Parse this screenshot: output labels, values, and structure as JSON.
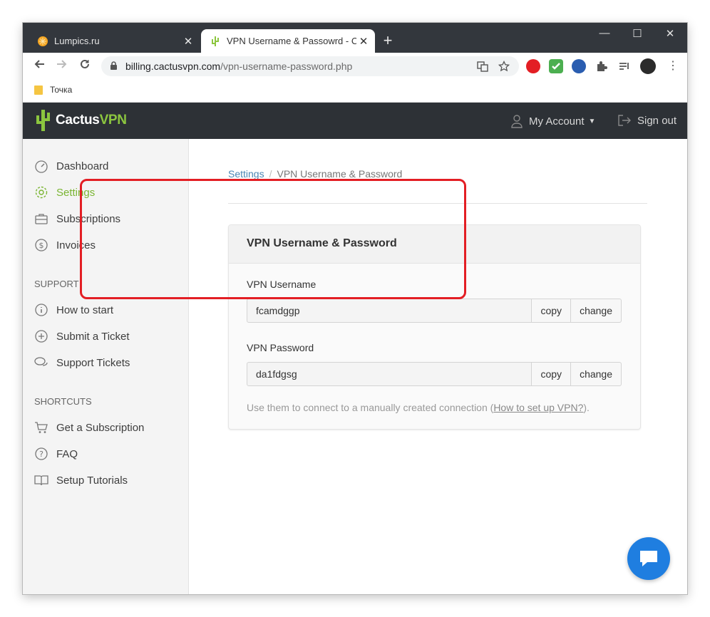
{
  "browser": {
    "tabs": [
      {
        "title": "Lumpics.ru",
        "active": false
      },
      {
        "title": "VPN Username & Passowrd - Cac",
        "active": true
      }
    ],
    "close_glyph": "✕",
    "new_tab_glyph": "+",
    "window_controls": {
      "minimize": "—",
      "maximize": "☐",
      "close": "✕"
    },
    "url_host": "billing.cactusvpn.com",
    "url_path": "/vpn-username-password.php",
    "bookmark": "Точка"
  },
  "header": {
    "logo_cactus": "Cactus",
    "logo_vpn": "VPN",
    "account_label": "My Account",
    "signout_label": "Sign out"
  },
  "sidebar": {
    "items": [
      {
        "label": "Dashboard",
        "icon": "dashboard-icon"
      },
      {
        "label": "Settings",
        "icon": "gear-icon",
        "active": true
      },
      {
        "label": "Subscriptions",
        "icon": "briefcase-icon"
      },
      {
        "label": "Invoices",
        "icon": "dollar-icon"
      }
    ],
    "support_heading": "SUPPORT",
    "support_items": [
      {
        "label": "How to start",
        "icon": "info-icon"
      },
      {
        "label": "Submit a Ticket",
        "icon": "plus-bubble-icon"
      },
      {
        "label": "Support Tickets",
        "icon": "chat-bubbles-icon"
      }
    ],
    "shortcuts_heading": "SHORTCUTS",
    "shortcut_items": [
      {
        "label": "Get a Subscription",
        "icon": "cart-icon"
      },
      {
        "label": "FAQ",
        "icon": "question-icon"
      },
      {
        "label": "Setup Tutorials",
        "icon": "book-icon"
      }
    ]
  },
  "breadcrumb": {
    "parent": "Settings",
    "separator": "/",
    "current": "VPN Username & Password"
  },
  "card": {
    "title": "VPN Username & Password",
    "username_label": "VPN Username",
    "username_value": "fcamdggp",
    "password_label": "VPN Password",
    "password_value": "da1fdgsg",
    "copy_label": "copy",
    "change_label": "change",
    "help_prefix": "Use them to connect to a manually created connection (",
    "help_link": "How to set up VPN?",
    "help_suffix": ")."
  },
  "colors": {
    "brand_green": "#8cc63f",
    "header_dark": "#2d3136",
    "highlight_red": "#e31e24",
    "chat_blue": "#1f7ee0"
  }
}
